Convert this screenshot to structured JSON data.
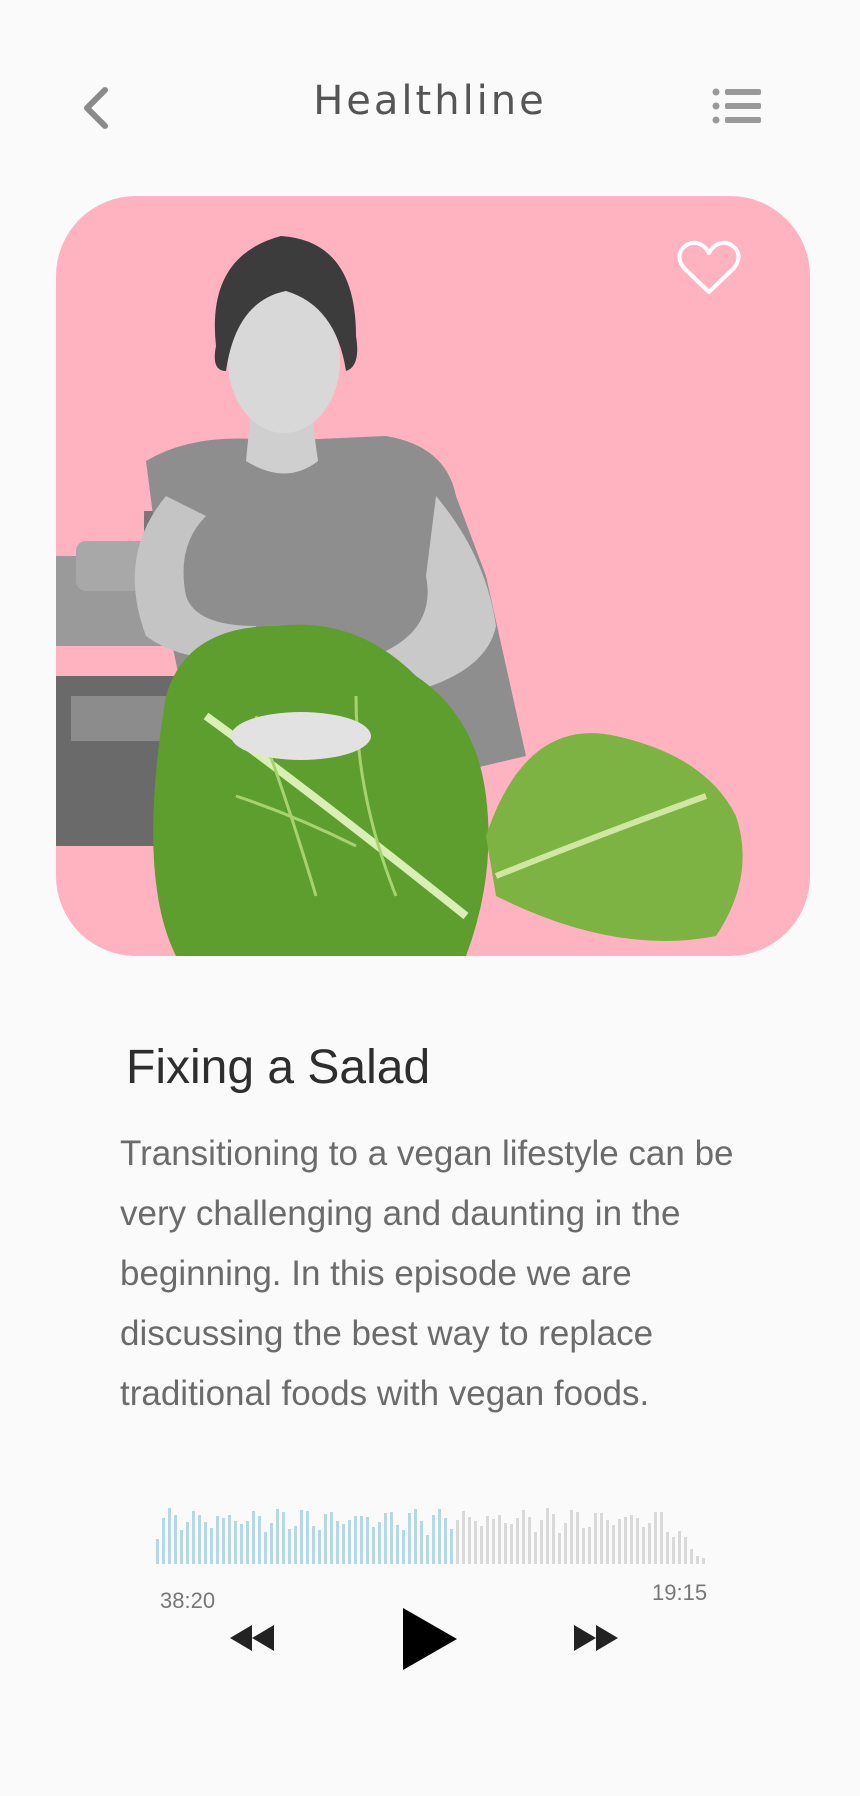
{
  "header": {
    "title": "Healthline",
    "back_icon": "chevron-left-icon",
    "menu_icon": "list-menu-icon"
  },
  "card": {
    "background_color": "#ffb3c1",
    "favorite_icon": "heart-outline-icon",
    "image_description_icon": "woman-sewing-lettuce-illustration"
  },
  "episode": {
    "title": "Fixing a Salad",
    "description": "Transitioning to a vegan lifestyle can be very challenging and daunting in the beginning.  In this episode we are discussing the best way to replace traditional foods with vegan foods."
  },
  "player": {
    "elapsed": "38:20",
    "remaining": "19:15",
    "progress": 0.54,
    "played_color": "#b6d7e6",
    "unplayed_color": "#d9d9d9",
    "rewind_icon": "rewind-icon",
    "play_icon": "play-icon",
    "forward_icon": "fast-forward-icon"
  }
}
